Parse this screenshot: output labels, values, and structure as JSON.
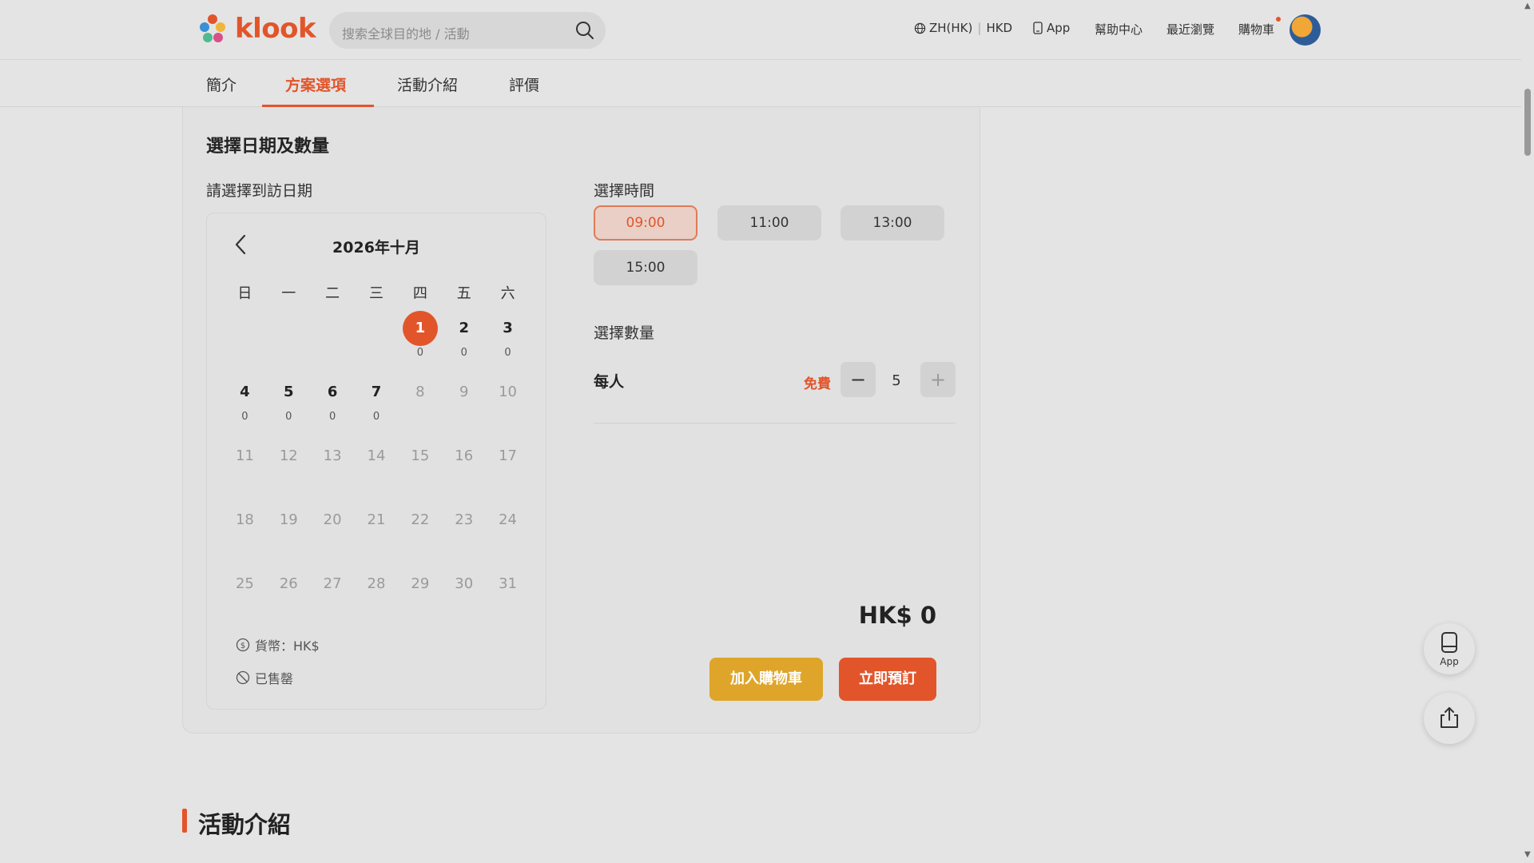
{
  "header": {
    "logo_text": "klook",
    "search_placeholder": "搜索全球目的地 / 活動",
    "lang": "ZH(HK)",
    "currency": "HKD",
    "app_label": "App",
    "help_label": "幫助中心",
    "recent_label": "最近瀏覽",
    "cart_label": "購物車"
  },
  "tabs": [
    {
      "label": "簡介"
    },
    {
      "label": "方案選項"
    },
    {
      "label": "活動介紹"
    },
    {
      "label": "評價"
    }
  ],
  "booking": {
    "section_title": "選擇日期及數量",
    "date_label": "請選擇到訪日期",
    "calendar": {
      "month": "2026年十月",
      "weekdays": [
        "日",
        "一",
        "二",
        "三",
        "四",
        "五",
        "六"
      ],
      "days": [
        {
          "num": "",
          "price": "",
          "state": "empty"
        },
        {
          "num": "",
          "price": "",
          "state": "empty"
        },
        {
          "num": "",
          "price": "",
          "state": "empty"
        },
        {
          "num": "",
          "price": "",
          "state": "empty"
        },
        {
          "num": "1",
          "price": "0",
          "state": "selected"
        },
        {
          "num": "2",
          "price": "0",
          "state": "avail"
        },
        {
          "num": "3",
          "price": "0",
          "state": "avail"
        },
        {
          "num": "4",
          "price": "0",
          "state": "avail"
        },
        {
          "num": "5",
          "price": "0",
          "state": "avail"
        },
        {
          "num": "6",
          "price": "0",
          "state": "avail"
        },
        {
          "num": "7",
          "price": "0",
          "state": "avail"
        },
        {
          "num": "8",
          "price": "",
          "state": "dis"
        },
        {
          "num": "9",
          "price": "",
          "state": "dis"
        },
        {
          "num": "10",
          "price": "",
          "state": "dis"
        },
        {
          "num": "11",
          "price": "",
          "state": "dis"
        },
        {
          "num": "12",
          "price": "",
          "state": "dis"
        },
        {
          "num": "13",
          "price": "",
          "state": "dis"
        },
        {
          "num": "14",
          "price": "",
          "state": "dis"
        },
        {
          "num": "15",
          "price": "",
          "state": "dis"
        },
        {
          "num": "16",
          "price": "",
          "state": "dis"
        },
        {
          "num": "17",
          "price": "",
          "state": "dis"
        },
        {
          "num": "18",
          "price": "",
          "state": "dis"
        },
        {
          "num": "19",
          "price": "",
          "state": "dis"
        },
        {
          "num": "20",
          "price": "",
          "state": "dis"
        },
        {
          "num": "21",
          "price": "",
          "state": "dis"
        },
        {
          "num": "22",
          "price": "",
          "state": "dis"
        },
        {
          "num": "23",
          "price": "",
          "state": "dis"
        },
        {
          "num": "24",
          "price": "",
          "state": "dis"
        },
        {
          "num": "25",
          "price": "",
          "state": "dis"
        },
        {
          "num": "26",
          "price": "",
          "state": "dis"
        },
        {
          "num": "27",
          "price": "",
          "state": "dis"
        },
        {
          "num": "28",
          "price": "",
          "state": "dis"
        },
        {
          "num": "29",
          "price": "",
          "state": "dis"
        },
        {
          "num": "30",
          "price": "",
          "state": "dis"
        },
        {
          "num": "31",
          "price": "",
          "state": "dis"
        }
      ],
      "legend_currency": "貨幣：HK$",
      "legend_soldout": "已售罄"
    },
    "time_label": "選擇時間",
    "times": [
      {
        "label": "09:00",
        "selected": true
      },
      {
        "label": "11:00",
        "selected": false
      },
      {
        "label": "13:00",
        "selected": false
      },
      {
        "label": "15:00",
        "selected": false
      }
    ],
    "quantity_label": "選擇數量",
    "per_person_label": "每人",
    "free_label": "免費",
    "minus_symbol": "−",
    "plus_symbol": "+",
    "quantity": "5",
    "total": "HK$ 0",
    "add_to_cart": "加入購物車",
    "book_now": "立即預訂"
  },
  "activity_intro_title": "活動介紹",
  "floating": {
    "app_label": "App"
  },
  "colors": {
    "accent": "#e2552a",
    "cart_button": "#dea52a"
  }
}
